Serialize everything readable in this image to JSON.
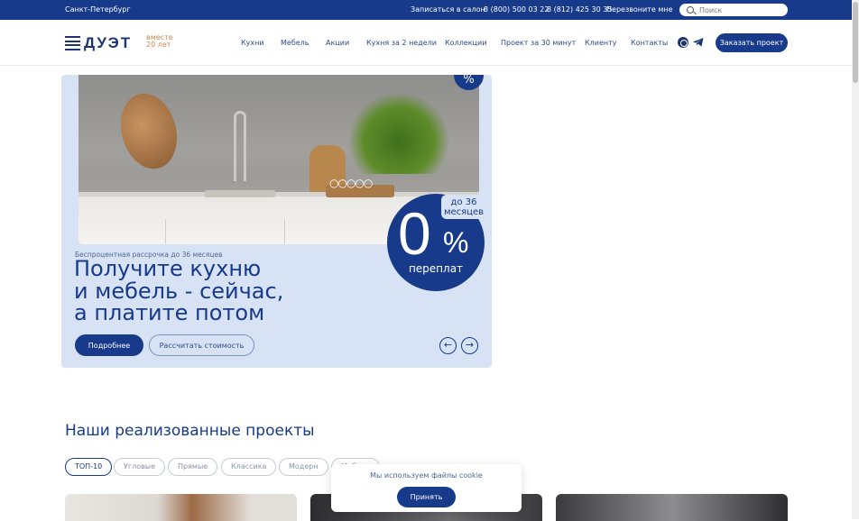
{
  "topbar": {
    "city": "Санкт-Петербург",
    "book_salon": "Записаться в салон",
    "phone1": "8 (800) 500 03 22",
    "phone2": "8 (812) 425 30 35",
    "callback": "Перезвоните мне",
    "search_placeholder": "Поиск"
  },
  "header": {
    "logo_word": "ДУЭТ",
    "logo_tagline": "вместе 20 лет",
    "nav": [
      "Кухни",
      "Мебель",
      "Акции",
      "Кухня за 2 недели",
      "Коллекции",
      "Проект за 30 минут",
      "Клиенту",
      "Контакты"
    ],
    "cta": "Заказать проект"
  },
  "hero": {
    "badge_top": "%",
    "subtitle": "Беспроцентная рассрочка до 36 месяцев",
    "title_lines": [
      "Получите кухню",
      "и мебель - сейчас,",
      "а платите потом"
    ],
    "badge_months": "до 36 месяцев",
    "badge_zero": "0",
    "badge_percent": "%",
    "badge_overpay": "переплат",
    "btn_more": "Подробнее",
    "btn_calc": "Рассчитать стоимость",
    "prev_arrow": "←",
    "next_arrow": "→"
  },
  "projects": {
    "title": "Наши реализованные проекты",
    "filters": [
      "ТОП-10",
      "Угловые",
      "Прямые",
      "Классика",
      "Модерн",
      "Мебель"
    ]
  },
  "cookie": {
    "message": "Мы используем файлы cookie",
    "accept": "Принять"
  },
  "colors": {
    "primary": "#173a8a",
    "hero_bg": "#d7e3f4",
    "accent_logo": "#c98a4b"
  }
}
